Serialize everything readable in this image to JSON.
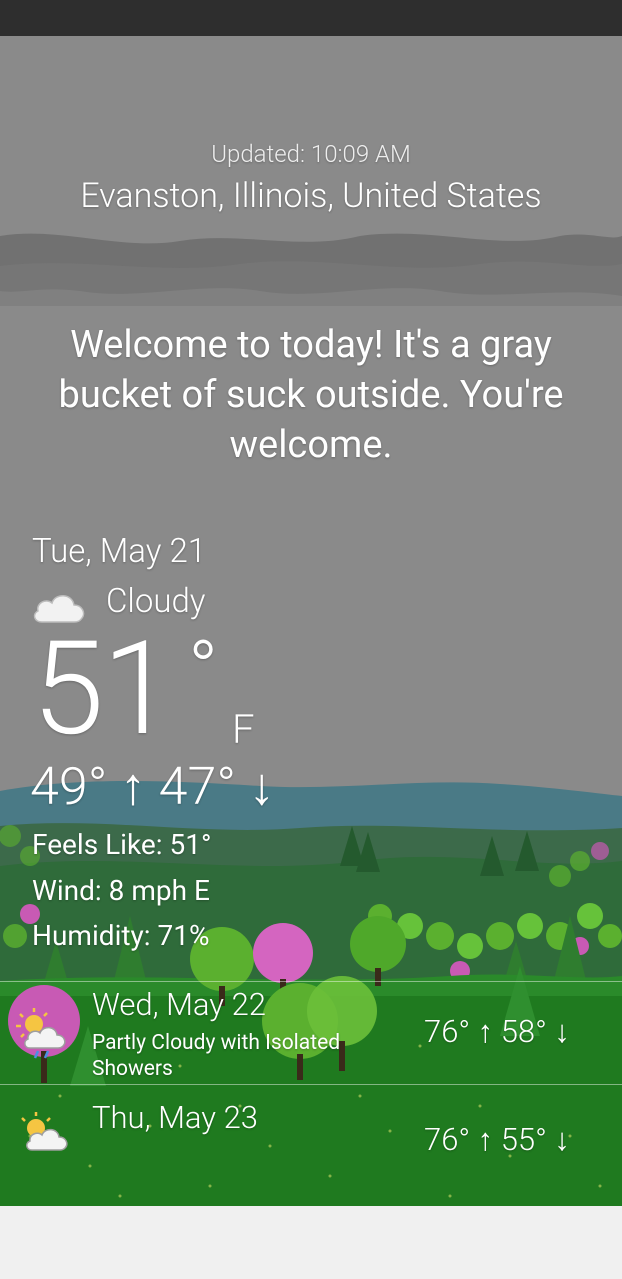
{
  "header": {
    "updated": "Updated: 10:09 AM",
    "location": "Evanston, Illinois, United States"
  },
  "message": "Welcome to today! It's a gray bucket of suck outside. You're welcome.",
  "current": {
    "date": "Tue, May 21",
    "condition": "Cloudy",
    "condition_icon": "cloud-icon",
    "temperature": "51",
    "degree_symbol": "°",
    "unit": "F",
    "hilo": "49° ↑ 47° ↓",
    "feels_like": "Feels Like: 51°",
    "wind": "Wind: 8 mph E",
    "humidity": "Humidity: 71%"
  },
  "forecast": [
    {
      "date": "Wed, May 22",
      "description": "Partly Cloudy with Isolated Showers",
      "temps": "76° ↑ 58° ↓",
      "icon": "partly-cloudy-showers-icon"
    },
    {
      "date": "Thu, May 23",
      "description": "",
      "temps": "76° ↑ 55° ↓",
      "icon": "partly-cloudy-icon"
    }
  ],
  "colors": {
    "sky": "#8a8a8a",
    "cloud_band": "#6e6e6e",
    "mountains": "#4a7a86",
    "grass": "#1f7a1f",
    "tree_green": "#5bb02f",
    "tree_pink": "#c85ab4",
    "status_bar": "#2e2e2e"
  }
}
